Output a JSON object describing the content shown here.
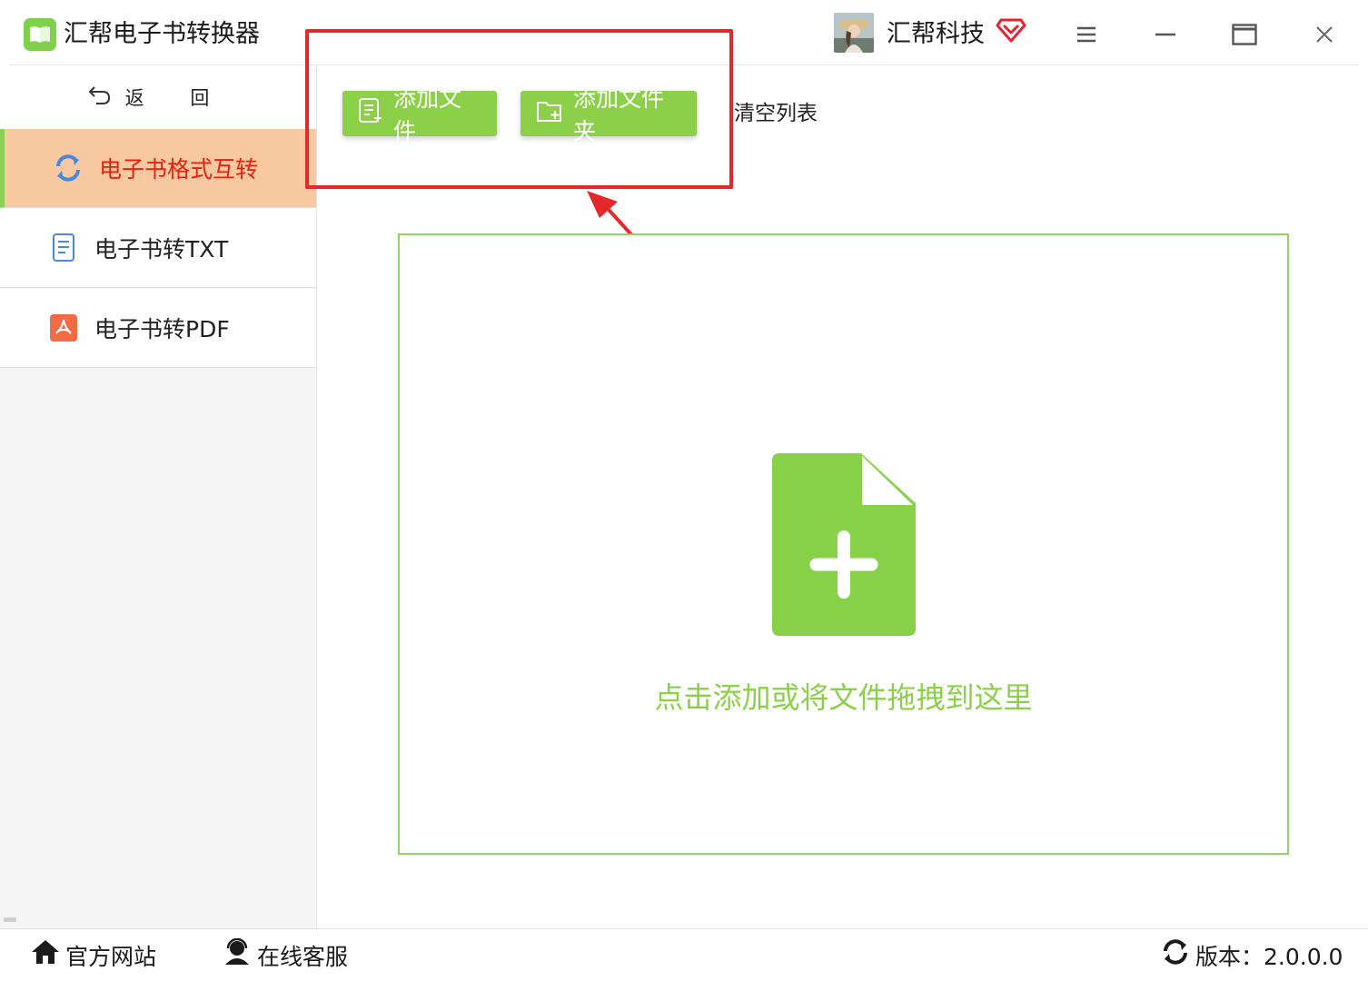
{
  "titlebar": {
    "app_title": "汇帮电子书转换器",
    "user_name": "汇帮科技"
  },
  "sidebar": {
    "back_label": "返 回",
    "items": [
      {
        "label": "电子书格式互转",
        "icon": "sync-icon",
        "active": true
      },
      {
        "label": "电子书转TXT",
        "icon": "txt-document-icon",
        "active": false
      },
      {
        "label": "电子书转PDF",
        "icon": "pdf-icon",
        "active": false
      }
    ]
  },
  "toolbar": {
    "add_file_label": "添加文件",
    "add_folder_label": "添加文件夹",
    "clear_list_label": "清空列表"
  },
  "drop_zone": {
    "hint": "点击添加或将文件拖拽到这里"
  },
  "footer": {
    "website_label": "官方网站",
    "service_label": "在线客服",
    "version_label": "版本：2.0.0.0"
  },
  "colors": {
    "accent_green": "#8cd04a",
    "active_bg": "#f8c9a0",
    "active_text": "#e8200f",
    "annotation_red": "#e5282a"
  }
}
